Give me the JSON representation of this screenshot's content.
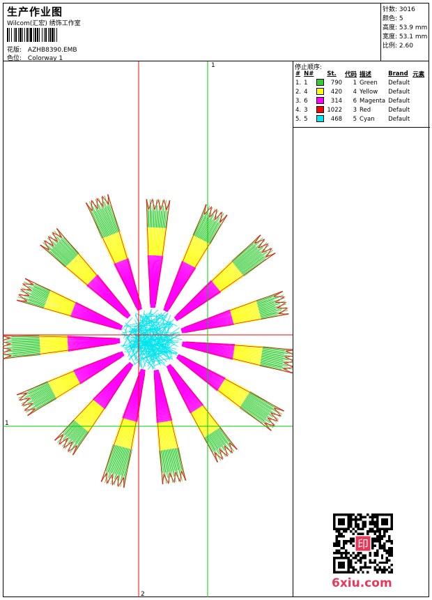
{
  "header": {
    "title": "生产作业图",
    "company": "Wilcom(汇宏) 绣饰工作室",
    "design_label": "花版:",
    "design_value": "AZHB8390.EMB",
    "colorway_label": "色位:",
    "colorway_value": "Colorway 1"
  },
  "stats": [
    {
      "label": "针数:",
      "value": "3016"
    },
    {
      "label": "颜色:",
      "value": "5"
    },
    {
      "label": "高度:",
      "value": "53.9 mm"
    },
    {
      "label": "宽度:",
      "value": "53.1 mm"
    },
    {
      "label": "比例:",
      "value": "2.60"
    }
  ],
  "sequence": {
    "title": "停止顺序:",
    "headers": [
      "#",
      "N#",
      "St.",
      "代码",
      "描述",
      "Brand",
      "元素"
    ],
    "rows": [
      {
        "idx": "1.",
        "n": "1",
        "color": "#33cc33",
        "st": "790",
        "code": "1",
        "desc": "Green",
        "brand": "Default"
      },
      {
        "idx": "2.",
        "n": "4",
        "color": "#ffff00",
        "st": "420",
        "code": "4",
        "desc": "Yellow",
        "brand": "Default"
      },
      {
        "idx": "3.",
        "n": "6",
        "color": "#ff00ff",
        "st": "314",
        "code": "6",
        "desc": "Magenta",
        "brand": "Default"
      },
      {
        "idx": "4.",
        "n": "3",
        "color": "#ff0000",
        "st": "1022",
        "code": "3",
        "desc": "Red",
        "brand": "Default"
      },
      {
        "idx": "5.",
        "n": "5",
        "color": "#00e5ee",
        "st": "468",
        "code": "5",
        "desc": "Cyan",
        "brand": "Default"
      }
    ]
  },
  "axes": {
    "top_label": "1",
    "left_label": "1",
    "bottom_label": "2"
  },
  "watermark": "6xiu.com",
  "qr_stamp": "印"
}
